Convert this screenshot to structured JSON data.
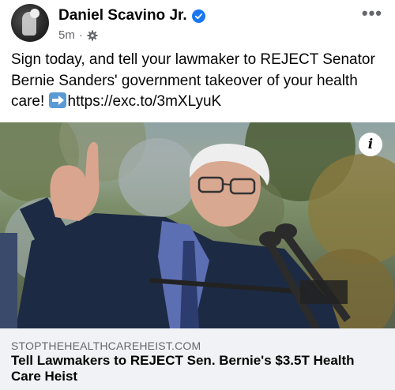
{
  "post": {
    "author": "Daniel Scavino Jr.",
    "timestamp": "5m",
    "separator": "·",
    "more_label": "•••",
    "text_before_emoji": "Sign today, and tell your lawmaker to REJECT Senator Bernie Sanders' government takeover of your health care! ",
    "link_text": "https://exc.to/3mXLyuK"
  },
  "link_card": {
    "info_label": "i",
    "domain": "STOPTHEHEALTHCAREHEIST.COM",
    "title": "Tell Lawmakers to REJECT Sen. Bernie's $3.5T Health Care Heist"
  },
  "icons": {
    "avatar": "avatar",
    "verified": "verified-badge-icon",
    "audience": "gear-icon",
    "more": "more-options-icon",
    "arrow": "right-arrow-emoji-icon",
    "info": "info-icon"
  },
  "colors": {
    "verified_blue": "#1877f2",
    "secondary_text": "#65676b",
    "card_footer_bg": "#f0f2f5"
  }
}
